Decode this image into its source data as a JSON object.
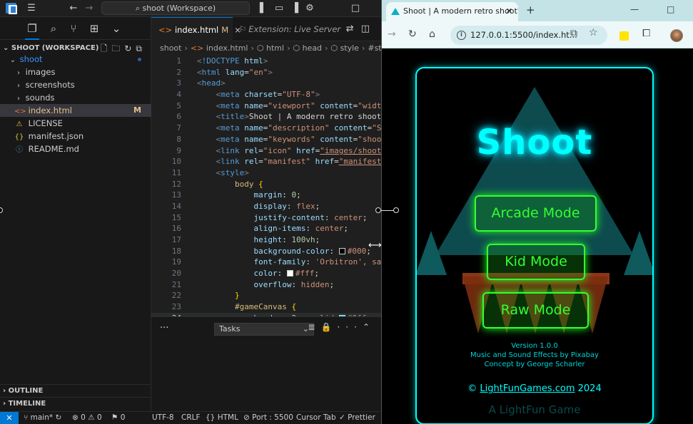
{
  "vscode": {
    "command_center": "shoot (Workspace)",
    "explorer": {
      "workspace_title": "SHOOT (WORKSPACE)",
      "folder": "shoot",
      "items": [
        {
          "name": "images",
          "kind": "folder"
        },
        {
          "name": "screenshots",
          "kind": "folder"
        },
        {
          "name": "sounds",
          "kind": "folder"
        },
        {
          "name": "index.html",
          "kind": "html",
          "badge": "M"
        },
        {
          "name": "LICENSE",
          "kind": "license"
        },
        {
          "name": "manifest.json",
          "kind": "json"
        },
        {
          "name": "README.md",
          "kind": "info"
        }
      ],
      "outline": "OUTLINE",
      "timeline": "TIMELINE"
    },
    "tabs": [
      {
        "label": "index.html",
        "badge": "M",
        "close": "×"
      },
      {
        "label": "Extension: Live Server"
      }
    ],
    "breadcrumb": [
      "shoot",
      "index.html",
      "html",
      "head",
      "style",
      "#sta"
    ],
    "line_numbers": [
      "1",
      "2",
      "3",
      "4",
      "5",
      "6",
      "7",
      "8",
      "9",
      "10",
      "11",
      "12",
      "13",
      "14",
      "15",
      "16",
      "17",
      "18",
      "19",
      "20",
      "21",
      "22",
      "23",
      "24"
    ],
    "panel": {
      "tasks_label": "Tasks"
    },
    "status": {
      "branch": "main*",
      "errors": "0",
      "warnings": "0",
      "ports_count": "0",
      "encoding": "UTF-8",
      "eol": "CRLF",
      "language": "HTML",
      "port": "Port : 5500",
      "cursor": "Cursor Tab",
      "prettier": "Prettier"
    },
    "colors": {
      "accent": "#0078d4",
      "modified": "#e2c08d"
    }
  },
  "browser": {
    "tab_title": "Shoot | A modern retro shoot'e",
    "url": "127.0.0.1:5500/index.ht...",
    "game": {
      "title": "Shoot",
      "buttons": [
        "Arcade Mode",
        "Kid Mode",
        "Raw Mode"
      ],
      "version": "Version 1.0.0",
      "music_credit": "Music and Sound Effects by Pixabay",
      "concept_credit": "Concept by George Scharler",
      "copyright_symbol": "©",
      "site": "LightFunGames.com",
      "year": "2024",
      "faded_text": "A LightFun Game"
    },
    "colors": {
      "neon_cyan": "#00ffff",
      "neon_green": "#33ff33"
    }
  }
}
